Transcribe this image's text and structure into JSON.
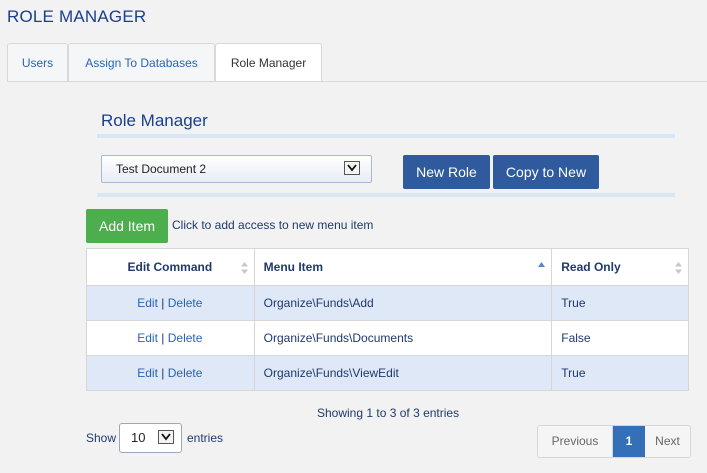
{
  "page": {
    "title": "ROLE MANAGER"
  },
  "tabs": [
    {
      "label": "Users",
      "active": false
    },
    {
      "label": "Assign To Databases",
      "active": false
    },
    {
      "label": "Role Manager",
      "active": true
    }
  ],
  "section": {
    "title": "Role Manager"
  },
  "role_select": {
    "value": "Test Document 2"
  },
  "buttons": {
    "new_role": "New Role",
    "copy_to_new": "Copy to New",
    "add_item": "Add Item",
    "add_item_hint": "Click to add access to new menu item"
  },
  "table": {
    "headers": {
      "edit_command": "Edit Command",
      "menu_item": "Menu Item",
      "read_only": "Read Only"
    },
    "rows": [
      {
        "edit": "Edit",
        "sep": "|",
        "delete": "Delete",
        "menu_item": "Organize\\Funds\\Add",
        "read_only": "True"
      },
      {
        "edit": "Edit",
        "sep": "|",
        "delete": "Delete",
        "menu_item": "Organize\\Funds\\Documents",
        "read_only": "False"
      },
      {
        "edit": "Edit",
        "sep": "|",
        "delete": "Delete",
        "menu_item": "Organize\\Funds\\ViewEdit",
        "read_only": "True"
      }
    ]
  },
  "info": "Showing 1 to 3 of 3 entries",
  "length": {
    "show": "Show",
    "value": "10",
    "entries": "entries"
  },
  "pagination": {
    "previous": "Previous",
    "current": "1",
    "next": "Next"
  },
  "colors": {
    "primary": "#2f5b9e",
    "success": "#4cae4c",
    "row_alt": "#dfe8f6",
    "page_active": "#3370b7"
  },
  "icons": {
    "dropdown": "chevron-down-icon",
    "sort": "sort-icon",
    "sort_asc": "sort-asc-icon"
  }
}
